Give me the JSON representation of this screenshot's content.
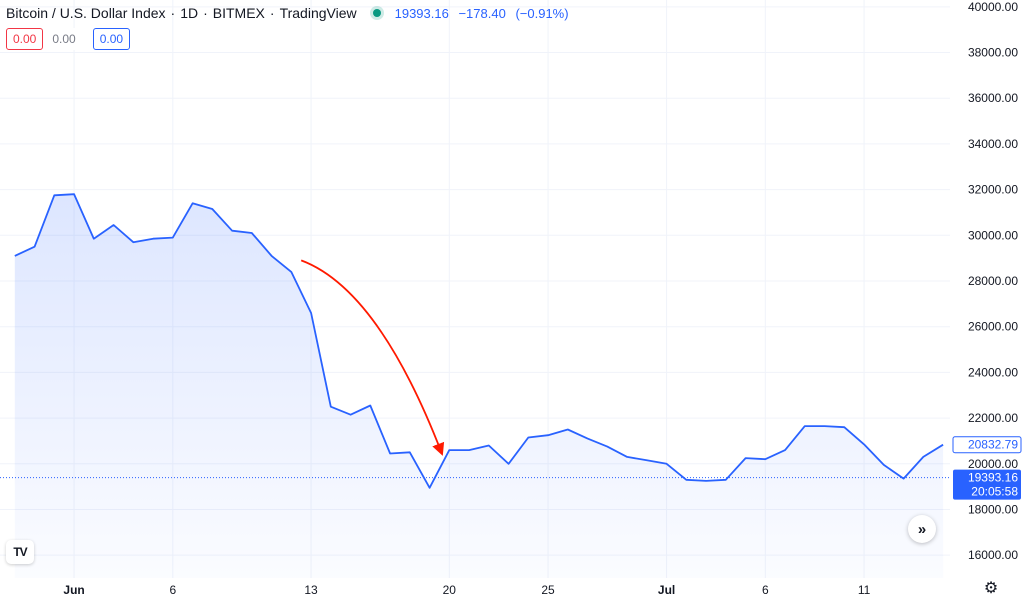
{
  "header": {
    "symbol": "Bitcoin / U.S. Dollar Index",
    "interval": "1D",
    "exchange": "BITMEX",
    "provider": "TradingView",
    "last_price": "19393.16",
    "change": "−178.40",
    "change_pct": "(−0.91%)",
    "status_color": "#089981"
  },
  "badges": {
    "sell": "0.00",
    "spread": "0.00",
    "buy": "0.00"
  },
  "price_labels": {
    "ref_price": "20832.79",
    "last_price": "19393.16",
    "countdown": "20:05:58"
  },
  "icons": {
    "scroll": "double-chevron-right-icon",
    "logo": "tradingview-logo-icon",
    "settings": "gear-icon"
  },
  "colors": {
    "line": "#2962ff",
    "arrow": "#ff1a00",
    "last_price_bg": "#2962ff"
  },
  "chart_data": {
    "type": "area",
    "x_ticks": [
      {
        "day": 0,
        "label": "Jun"
      },
      {
        "day": 5,
        "label": "6"
      },
      {
        "day": 12,
        "label": "13"
      },
      {
        "day": 19,
        "label": "20"
      },
      {
        "day": 24,
        "label": "25"
      },
      {
        "day": 30,
        "label": "Jul"
      },
      {
        "day": 35,
        "label": "6"
      },
      {
        "day": 40,
        "label": "11"
      }
    ],
    "y_ticks": [
      16000,
      18000,
      20000,
      22000,
      24000,
      26000,
      28000,
      30000,
      32000,
      34000,
      36000,
      38000,
      40000
    ],
    "ylim": [
      15000,
      40300
    ],
    "x": [
      -3,
      -2,
      -1,
      0,
      1,
      2,
      3,
      4,
      5,
      6,
      7,
      8,
      9,
      10,
      11,
      12,
      13,
      14,
      15,
      16,
      17,
      18,
      19,
      20,
      21,
      22,
      23,
      24,
      25,
      26,
      27,
      28,
      29,
      30,
      31,
      32,
      33,
      34,
      35,
      36,
      37,
      38,
      39,
      40,
      41,
      42,
      43,
      44
    ],
    "values": [
      29100,
      29500,
      31750,
      31800,
      29850,
      30450,
      29700,
      29850,
      29900,
      31400,
      31150,
      30200,
      30100,
      29100,
      28400,
      26600,
      22500,
      22150,
      22550,
      20450,
      20500,
      18950,
      20600,
      20600,
      20800,
      20000,
      21150,
      21250,
      21500,
      21100,
      20750,
      20300,
      20150,
      20000,
      19300,
      19250,
      19300,
      20250,
      20200,
      20600,
      21650,
      21650,
      21600,
      20850,
      19950,
      19350,
      20300,
      20832.79
    ],
    "last_price": 19393.16,
    "arrow": {
      "from": [
        11.5,
        28900
      ],
      "to": [
        18.6,
        20500
      ]
    }
  }
}
